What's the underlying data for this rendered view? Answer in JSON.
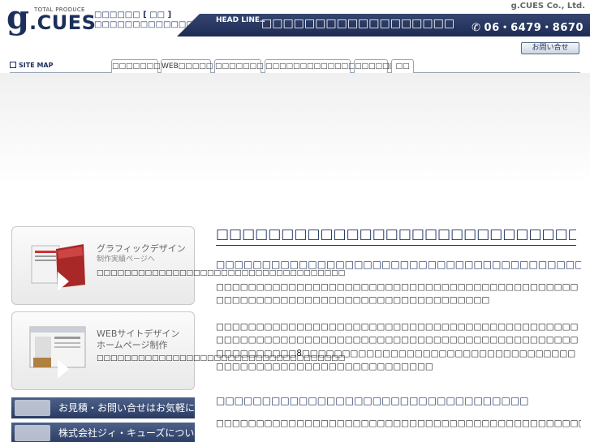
{
  "header": {
    "logo_g": "g",
    "logo_small": "TOTAL PRODUCE",
    "logo_cues": ".CUES",
    "tagline_1": "□□□□□□ [ □□ ]",
    "tagline_2": "□□□□□□□□□□□□□",
    "headline_label": "HEAD LINE..",
    "headline_text": "□□□□□□□□□□□□□□□□□□",
    "company": "g.CUES Co., Ltd.",
    "phone": "06・6479・8670",
    "contact_button": "お問い合せ"
  },
  "nav": {
    "sitemap_label": "SITE MAP",
    "tabs": [
      {
        "label": "□□□□□□□"
      },
      {
        "label": "WEB□□□□□"
      },
      {
        "label": "□□□□□□□"
      },
      {
        "label": "□□□□□□□□□□□□□□□□□□□□"
      },
      {
        "label": "□□□□□"
      },
      {
        "label": "□□"
      }
    ]
  },
  "sidebar": {
    "card1": {
      "title": "グラフィックデザイン",
      "sub": "制作実績ページへ",
      "desc": "□□□□□□□□□□□□□□□□□□□□□□□□□□□□□□□□□□□□"
    },
    "card2": {
      "title": "WEBサイトデザイン",
      "sub": "ホームページ制作",
      "desc": "□□□□□□□□□□□□□□□□□□□□□□□□□□□□□□□□□□□□"
    },
    "banner1": "お見積・お問い合せはお気軽に",
    "banner2": "株式会社ジィ・キューズについて"
  },
  "main": {
    "title": "□□□□□□□□□□□□□□□□□□□□□□□□□□□□□□□□□□□□□□□□□□",
    "subtitle": "□□□□□□□□□□□□□□□□□□□□□□□□□□□□□□□□□□□□□□□□□□□□□□□□□□",
    "para1": "□□□□□□□□□□□□□□□□□□□□□□□□□□□□□□□□□□□□□□□□□□□□□□□□□□□□□□□□□□□□□□□□□□□□□□□□□□□□□□□",
    "para2": "□□□□□□□□□□□□□□□□□□□□□□□□□□□□□□□□□□□□□□□□□□□□□□□□□□□□□□□□□□□□□□□□□□□□□□□□□□□□□□□□□□□□□□□□□□□□□□□□□□□□8□□□□□□□□□□□□□□□□□□□□□□□□□□□□□□□□□□□□□□□□□□□□□□□□□□□□□□□□□□□□□",
    "section_title": "□□□□□□□□□□□□□□□□□□□□□□□□□□□□□□□□□□",
    "para3": "□□□□□□□□□□□□□□□□□□□□□□□□□□□□□□□□□□□□□□□□□□□□□□"
  }
}
